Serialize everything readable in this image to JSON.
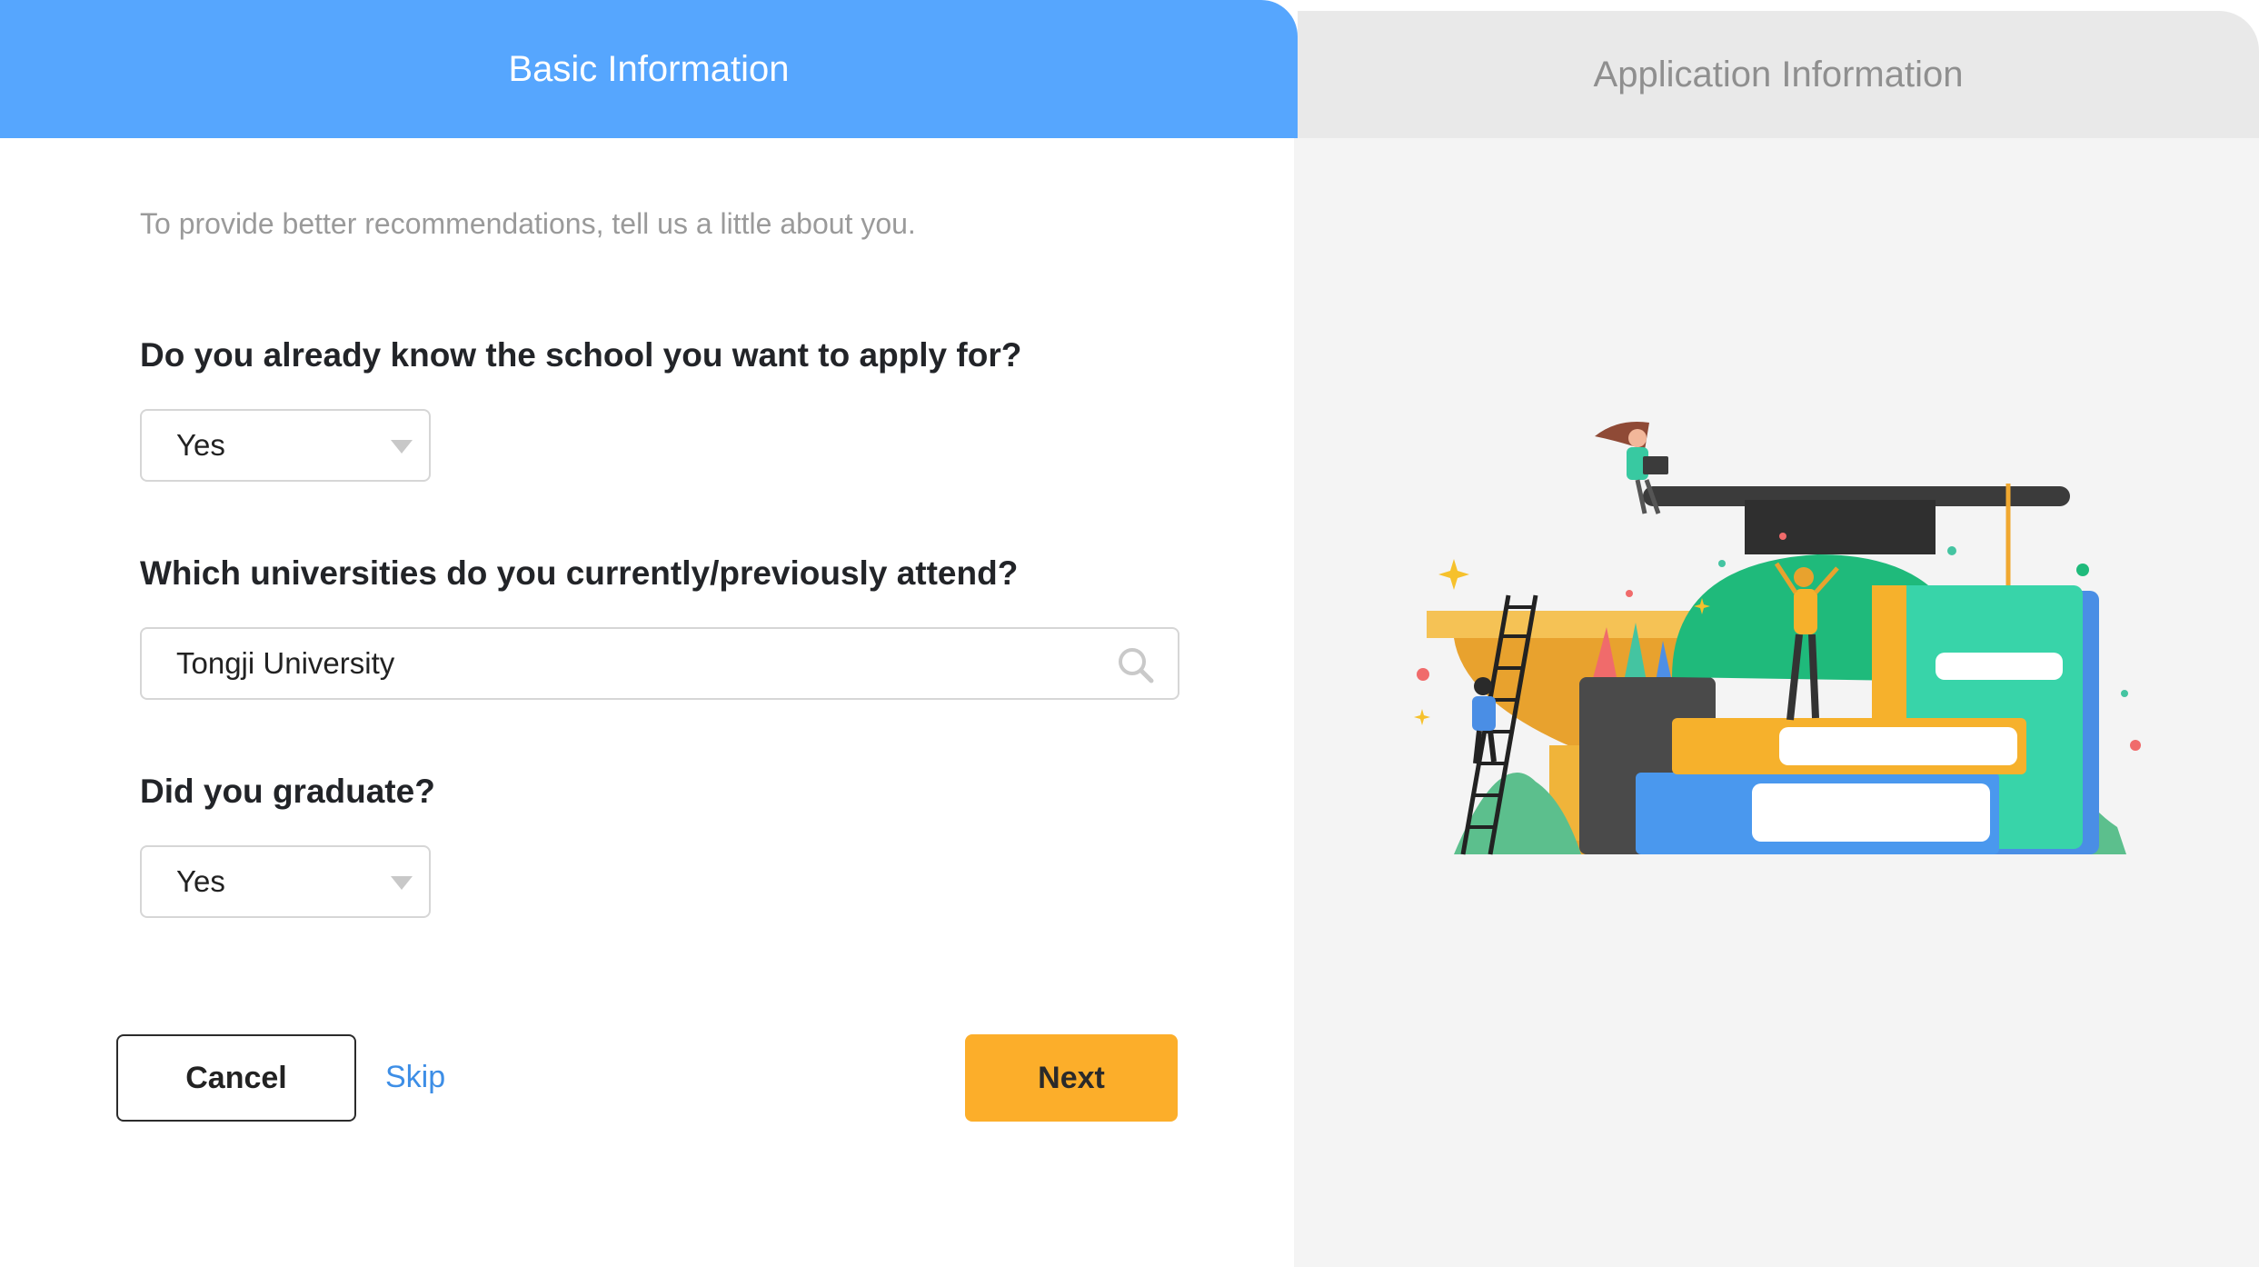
{
  "tabs": [
    {
      "label": "Basic Information",
      "active": true
    },
    {
      "label": "Application Information",
      "active": false
    }
  ],
  "form": {
    "intro": "To provide better recommendations, tell us a little about you.",
    "question_school": "Do you already know the school you want to apply for?",
    "school_known_value": "Yes",
    "question_university": "Which universities do you currently/previously attend?",
    "university_value": "Tongji University",
    "question_graduated": "Did you graduate?",
    "graduated_value": "Yes"
  },
  "actions": {
    "cancel_label": "Cancel",
    "skip_label": "Skip",
    "next_label": "Next"
  },
  "colors": {
    "tab_active": "#56a6fe",
    "next_button": "#fcae2a",
    "skip_link": "#3d8ee6"
  },
  "icons": {
    "search": "search-icon",
    "dropdown": "chevron-down-icon",
    "illustration": "education-illustration"
  }
}
